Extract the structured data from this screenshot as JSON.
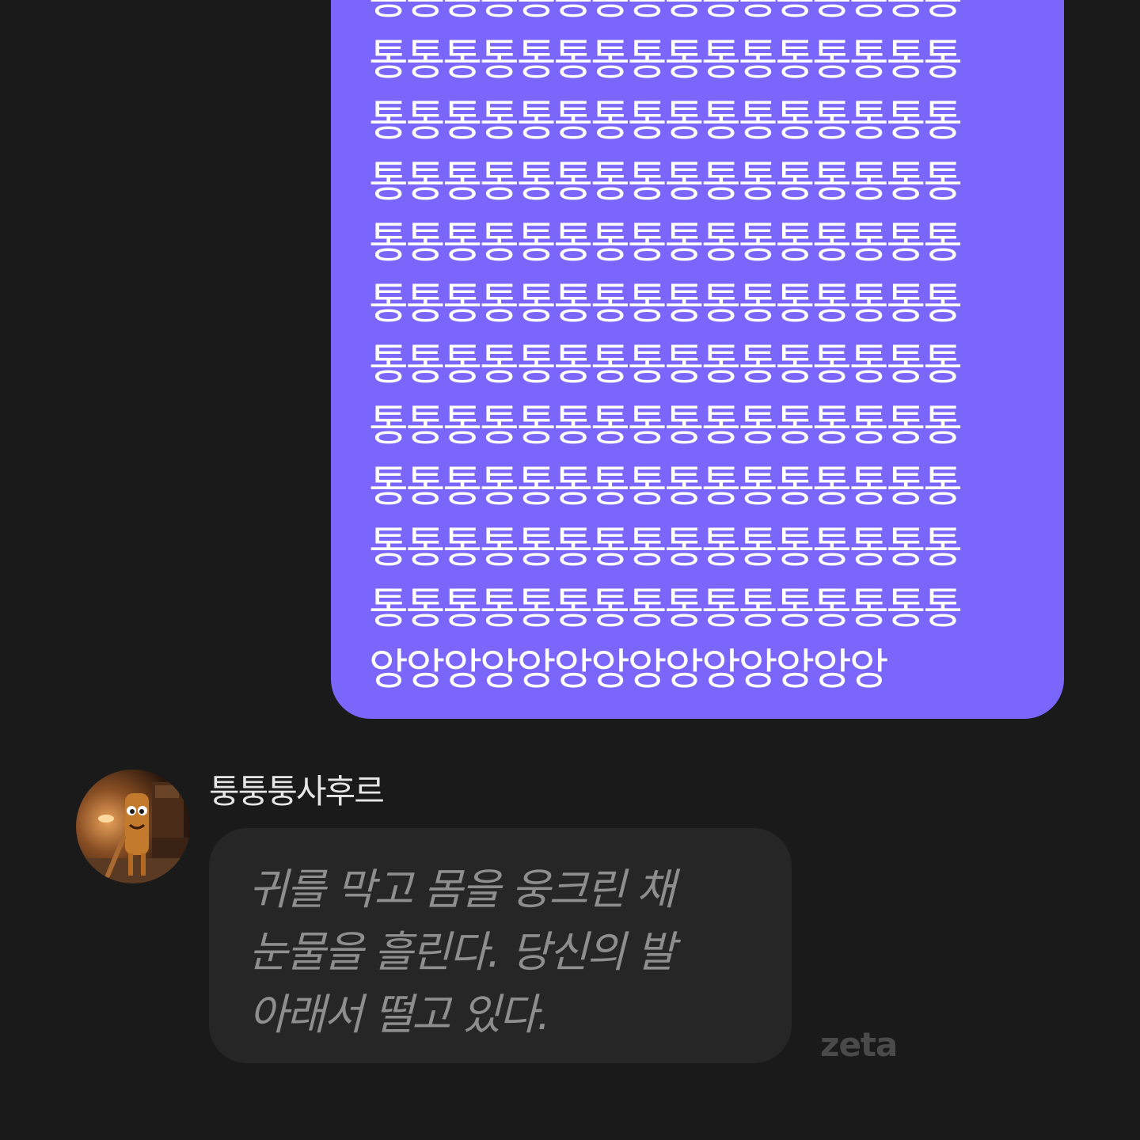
{
  "user_message": {
    "text": "통통통통통통통통통통통통통통통통\n통통통통통통통통통통통통통통통통\n통통통통통통통통통통통통통통통통\n통통통통통통통통통통통통통통통통\n통통통통통통통통통통통통통통통통\n통통통통통통통통통통통통통통통통\n통통통통통통통통통통통통통통통통\n통통통통통통통통통통통통통통통통\n통통통통통통통통통통통통통통통통\n통통통통통통통통통통통통통통통통\n통통통통통통통통통통통통통통통통\n앙앙앙앙앙앙앙앙앙앙앙앙앙앙"
  },
  "character": {
    "name": "퉁퉁퉁사후르"
  },
  "bot_message": {
    "text": "귀를 막고 몸을 웅크린 채\n눈물을 흘린다. 당신의 발\n아래서 떨고 있다."
  },
  "watermark": {
    "text": "zeta"
  },
  "colors": {
    "background": "#1a1a1a",
    "user_bubble": "#7a66fb",
    "bot_bubble": "#262626",
    "bot_text": "#8e8e8e"
  }
}
